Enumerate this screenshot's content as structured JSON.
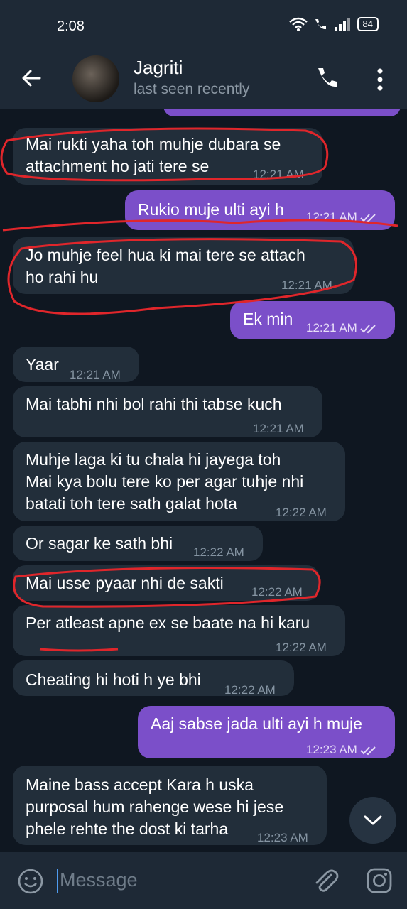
{
  "status_bar": {
    "time": "2:08",
    "battery": "84"
  },
  "header": {
    "title": "Jagriti",
    "subtitle": "last seen recently"
  },
  "messages": [
    {
      "dir": "in",
      "text": "Mai rukti yaha toh muhje dubara se\nattachment ho jati tere se",
      "time": "12:21 AM"
    },
    {
      "dir": "out",
      "text": "Rukio muje ulti ayi h",
      "time": "12:21 AM"
    },
    {
      "dir": "in",
      "text": "Jo muhje feel hua ki mai tere se attach\nho rahi hu",
      "time": "12:21 AM"
    },
    {
      "dir": "out",
      "text": "Ek min",
      "time": "12:21 AM"
    },
    {
      "dir": "in",
      "text": "Yaar",
      "time": "12:21 AM"
    },
    {
      "dir": "in",
      "text": "Mai tabhi nhi bol rahi thi tabse kuch",
      "time": "12:21 AM"
    },
    {
      "dir": "in",
      "text": "Muhje laga ki tu chala hi jayega toh\nMai kya bolu tere ko per agar tuhje nhi\nbatati toh tere sath galat hota",
      "time": "12:22 AM"
    },
    {
      "dir": "in",
      "text": "Or sagar ke sath bhi",
      "time": "12:22 AM"
    },
    {
      "dir": "in",
      "text": "Mai usse pyaar nhi de sakti",
      "time": "12:22 AM"
    },
    {
      "dir": "in",
      "text": "Per atleast apne ex se baate na hi karu",
      "time": "12:22 AM"
    },
    {
      "dir": "in",
      "text": "Cheating hi hoti h ye bhi",
      "time": "12:22 AM"
    },
    {
      "dir": "out",
      "text": "Aaj sabse jada ulti ayi h muje",
      "time": "12:23 AM"
    },
    {
      "dir": "in",
      "text": "Maine bass accept Kara h uska\npurposal hum rahenge wese hi jese\nphele rehte the dost ki tarha",
      "time": "12:23 AM"
    }
  ],
  "input": {
    "placeholder": "Message"
  },
  "colors": {
    "incoming": "#222e3a",
    "outgoing": "#7b4fc9",
    "header": "#1e2936",
    "annotation": "#e0262b"
  }
}
